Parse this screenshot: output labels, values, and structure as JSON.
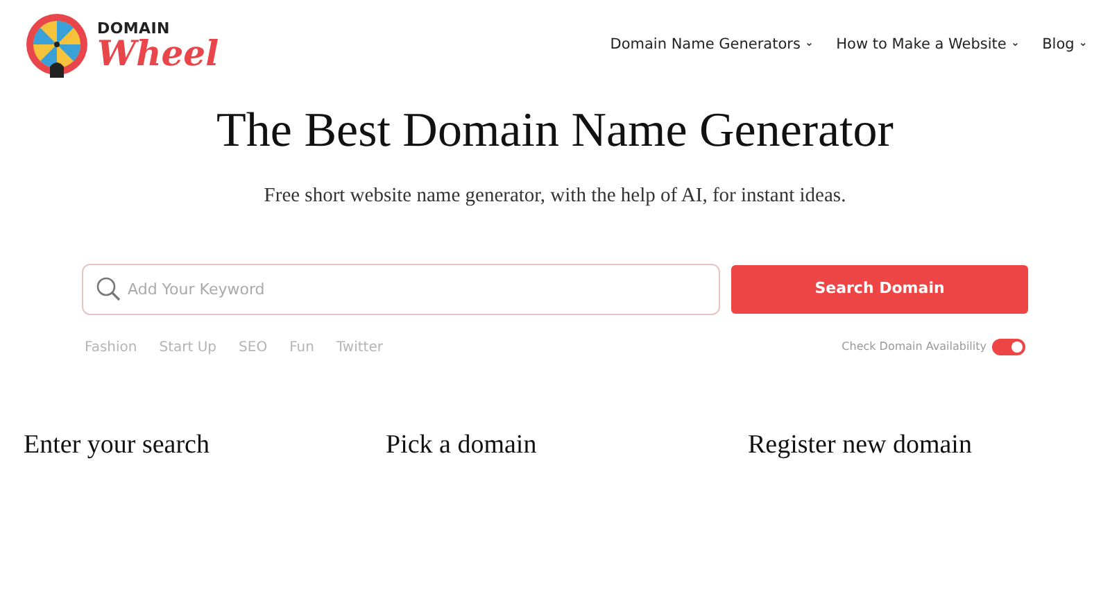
{
  "logo": {
    "top": "DOMAIN",
    "bottom": "Wheel"
  },
  "nav": [
    {
      "label": "Domain Name Generators",
      "caret": "⌄"
    },
    {
      "label": "How to Make a Website",
      "caret": "⌄"
    },
    {
      "label": "Blog",
      "caret": "⌄"
    }
  ],
  "hero": {
    "title": "The Best Domain Name Generator",
    "subtitle": "Free short website name generator, with the help of AI, for instant ideas."
  },
  "search": {
    "placeholder": "Add Your Keyword",
    "button": "Search Domain"
  },
  "tags": [
    "Fashion",
    "Start Up",
    "SEO",
    "Fun",
    "Twitter"
  ],
  "availability": {
    "label": "Check Domain Availability",
    "on": true
  },
  "steps": [
    "Enter your search",
    "Pick a domain",
    "Register new domain"
  ]
}
